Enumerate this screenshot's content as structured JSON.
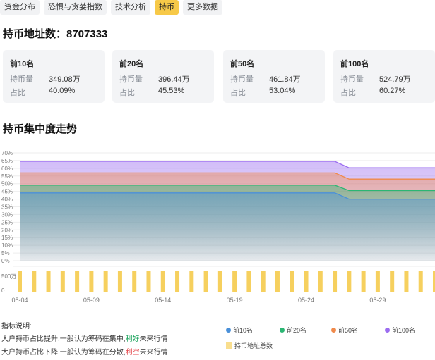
{
  "tabs": [
    {
      "label": "资金分布",
      "active": false
    },
    {
      "label": "恐惧与贪婪指数",
      "active": false
    },
    {
      "label": "技术分析",
      "active": false
    },
    {
      "label": "持币",
      "active": true
    },
    {
      "label": "更多数据",
      "active": false
    }
  ],
  "address_count": "持币地址数：8707333",
  "cards": [
    {
      "name": "前10名",
      "amount_label": "持币量",
      "amount": "349.08万",
      "ratio_label": "占比",
      "ratio": "40.09%"
    },
    {
      "name": "前20名",
      "amount_label": "持币量",
      "amount": "396.44万",
      "ratio_label": "占比",
      "ratio": "45.53%"
    },
    {
      "name": "前50名",
      "amount_label": "持币量",
      "amount": "461.84万",
      "ratio_label": "占比",
      "ratio": "53.04%"
    },
    {
      "name": "前100名",
      "amount_label": "持币量",
      "amount": "524.79万",
      "ratio_label": "占比",
      "ratio": "60.27%"
    }
  ],
  "trend_title": "持币集中度走势",
  "colors": {
    "top10": "#4a90d9",
    "top20": "#2bb673",
    "top50": "#f08a4b",
    "top100": "#9b6cf0",
    "addresses": "#f5c842",
    "active_tab": "#f7c948"
  },
  "chart_data": {
    "type": "line",
    "y_ticks": [
      "70%",
      "65%",
      "60%",
      "55%",
      "50%",
      "45%",
      "40%",
      "35%",
      "30%",
      "25%",
      "20%",
      "15%",
      "10%",
      "5%",
      "0%"
    ],
    "ylim": [
      0,
      70
    ],
    "address_axis_ticks": [
      "500万",
      "0"
    ],
    "x_tick_labels": [
      "05-04",
      "05-09",
      "05-14",
      "05-19",
      "05-24",
      "05-29"
    ],
    "x": [
      "05-04",
      "05-05",
      "05-06",
      "05-07",
      "05-08",
      "05-09",
      "05-10",
      "05-11",
      "05-12",
      "05-13",
      "05-14",
      "05-15",
      "05-16",
      "05-17",
      "05-18",
      "05-19",
      "05-20",
      "05-21",
      "05-22",
      "05-23",
      "05-24",
      "05-25",
      "05-26",
      "05-27",
      "05-28",
      "05-29",
      "05-30",
      "05-31",
      "06-01",
      "06-02"
    ],
    "series": [
      {
        "name": "前10名",
        "values": [
          44,
          44,
          44,
          44,
          44,
          44,
          44,
          44,
          44,
          44,
          44,
          44,
          44,
          44,
          44,
          44,
          44,
          44,
          44,
          44,
          44,
          44,
          44,
          40,
          40,
          40,
          40,
          40,
          40,
          40
        ]
      },
      {
        "name": "前20名",
        "values": [
          49,
          49,
          49,
          49,
          49,
          49,
          49,
          49,
          49,
          49,
          49,
          49,
          49,
          49,
          49,
          49,
          49,
          49,
          49,
          49,
          49,
          49,
          49,
          45.5,
          45.5,
          45.5,
          45.5,
          45.5,
          45.5,
          45.5
        ]
      },
      {
        "name": "前50名",
        "values": [
          57,
          57,
          57,
          57,
          57,
          57,
          57,
          57,
          57,
          57,
          57,
          57,
          57,
          57,
          57,
          57,
          57,
          57,
          57,
          57,
          57,
          57,
          57,
          53,
          53,
          53,
          53,
          53,
          53,
          53
        ]
      },
      {
        "name": "前100名",
        "values": [
          64.5,
          64.5,
          64.5,
          64.5,
          64.5,
          64.5,
          64.5,
          64.5,
          64.5,
          64.5,
          64.5,
          64.5,
          64.5,
          64.5,
          64.5,
          64.5,
          64.5,
          64.5,
          64.5,
          64.5,
          64.5,
          64.5,
          64.5,
          60.3,
          60.3,
          60.3,
          60.3,
          60.3,
          60.3,
          60.3
        ]
      }
    ],
    "address_bars": {
      "name": "持币地址总数",
      "values": [
        870,
        870,
        870,
        870,
        870,
        870,
        870,
        870,
        870,
        870,
        870,
        870,
        870,
        870,
        870,
        870,
        870,
        870,
        870,
        870,
        870,
        870,
        870,
        870,
        870,
        870,
        870,
        870,
        870,
        870
      ],
      "ylim": [
        0,
        1000
      ]
    },
    "grid": true,
    "legend_position": "bottom-right"
  },
  "notes": {
    "title": "指标说明:",
    "line1_pre": "大户持币占比提升,一般认为筹码在集中,",
    "line1_tag": "利好",
    "line1_post": "未来行情",
    "line2_pre": "大户持币占比下降,一般认为筹码在分散,",
    "line2_tag": "利空",
    "line2_post": "未来行情"
  }
}
